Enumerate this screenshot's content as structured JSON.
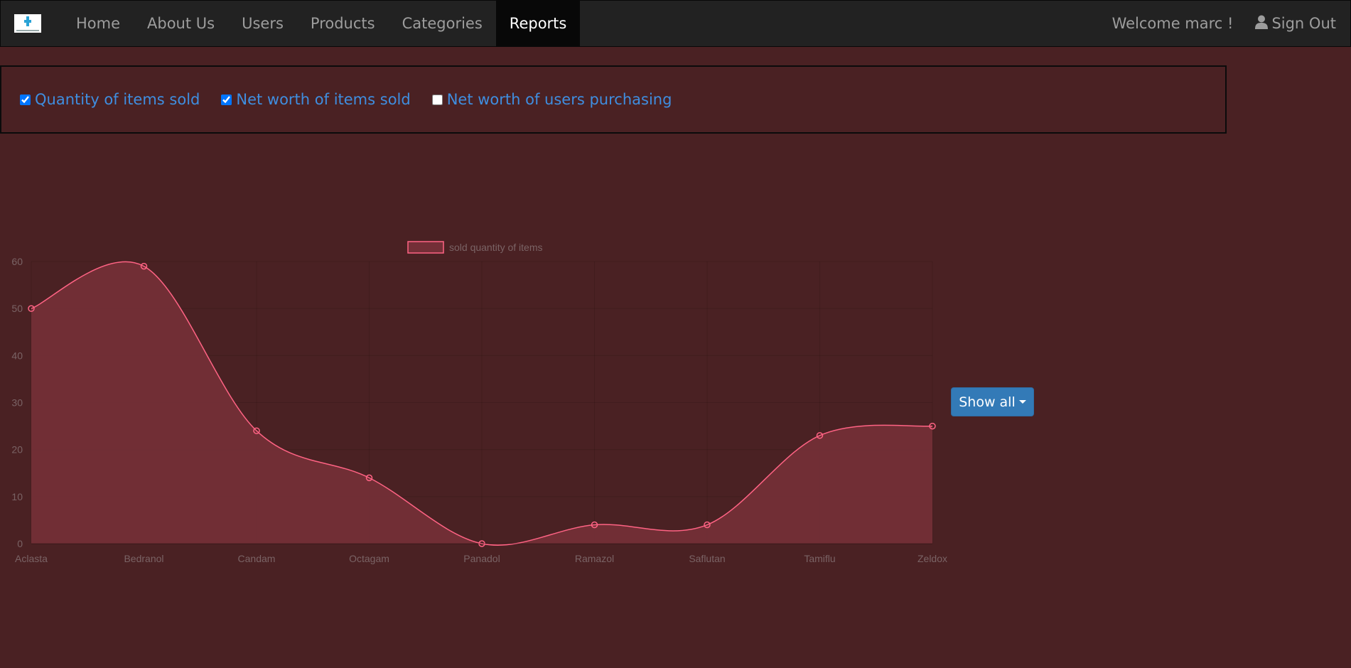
{
  "nav": {
    "items": [
      {
        "label": "Home"
      },
      {
        "label": "About Us"
      },
      {
        "label": "Users"
      },
      {
        "label": "Products"
      },
      {
        "label": "Categories"
      },
      {
        "label": "Reports",
        "active": true
      }
    ],
    "welcome": "Welcome marc !",
    "signout": "Sign Out"
  },
  "filters": [
    {
      "label": "Quantity of items sold",
      "checked": true
    },
    {
      "label": "Net worth of items sold",
      "checked": true
    },
    {
      "label": "Net worth of users purchasing",
      "checked": false
    }
  ],
  "show_all_label": "Show all",
  "colors": {
    "background": "#4a2123",
    "line": "#ff6384",
    "area_fill": "#732f37",
    "link": "#3f8ee0",
    "button": "#337ab7"
  },
  "chart_data": {
    "type": "line",
    "categories": [
      "Aclasta",
      "Bedranol",
      "Candam",
      "Octagam",
      "Panadol",
      "Ramazol",
      "Saflutan",
      "Tamiflu",
      "Zeldox"
    ],
    "series": [
      {
        "name": "sold quantity of items",
        "values": [
          50,
          59,
          24,
          14,
          0,
          4,
          4,
          23,
          25
        ]
      }
    ],
    "ylim": [
      0,
      60
    ],
    "yticks": [
      0,
      10,
      20,
      30,
      40,
      50,
      60
    ],
    "grid": true,
    "filled": true,
    "legend": "top"
  }
}
